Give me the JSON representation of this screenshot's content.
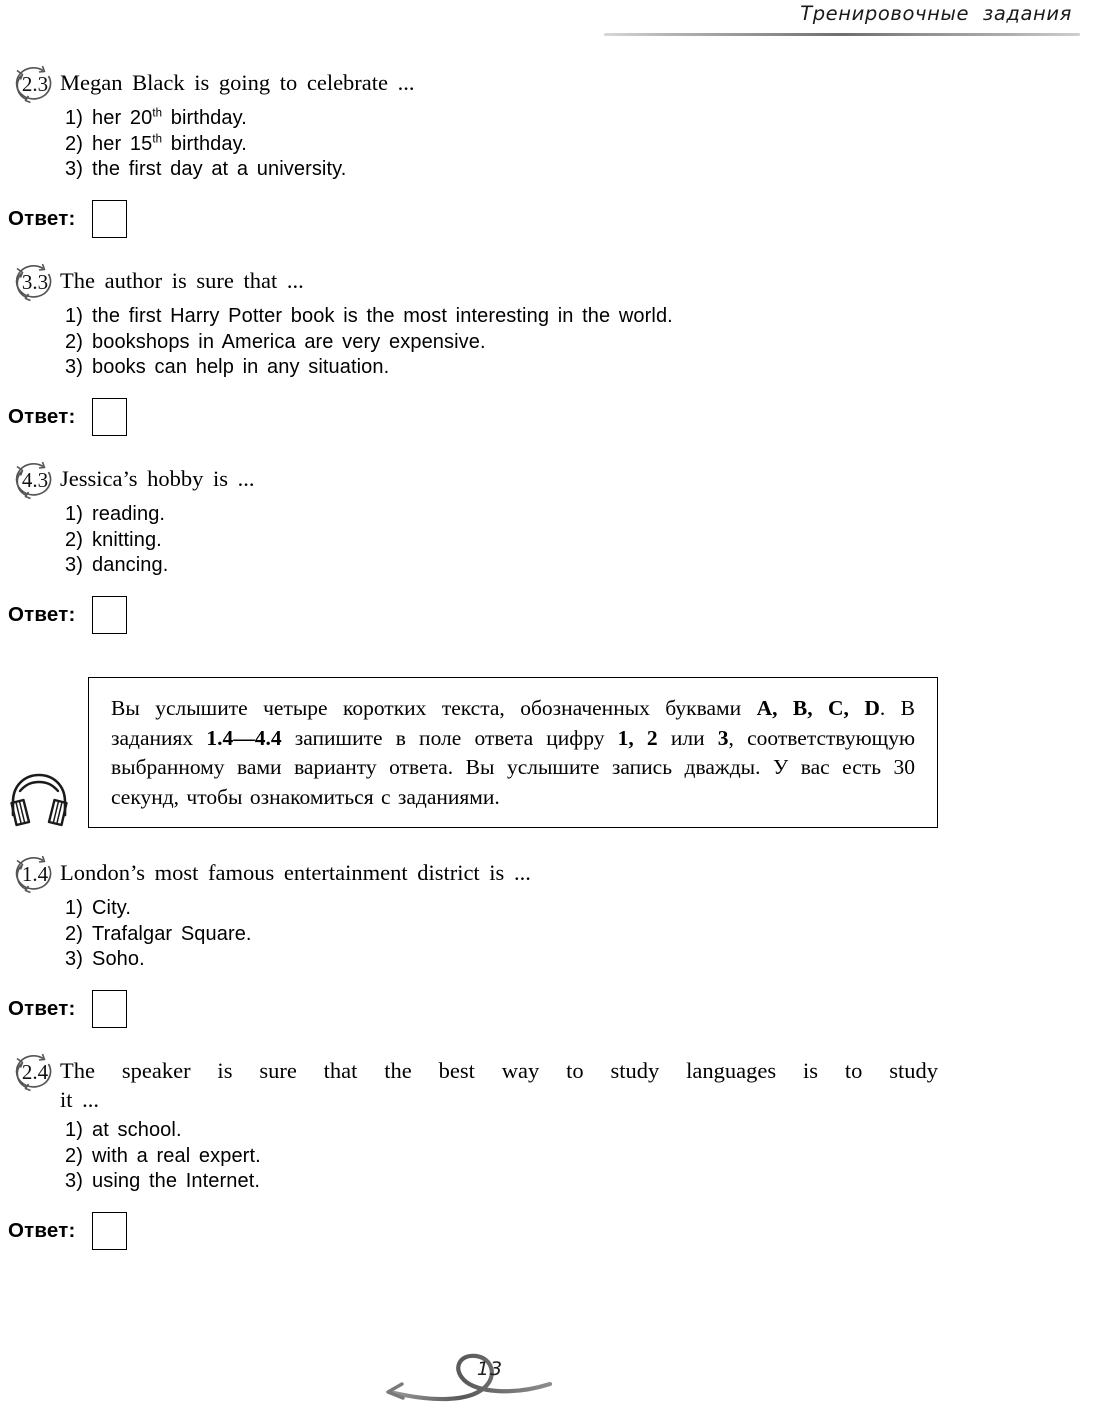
{
  "header": {
    "running_title": "Тренировочные  задания"
  },
  "questions": [
    {
      "number": "2.3",
      "marker_icon": "circular-arrow-icon",
      "prompt_lines": [
        "Megan  Black  is  going  to  celebrate  ..."
      ],
      "options": [
        {
          "num": "1)",
          "text": "her  20",
          "sup": "th",
          "tail": "  birthday."
        },
        {
          "num": "2)",
          "text": "her  15",
          "sup": "th",
          "tail": "  birthday."
        },
        {
          "num": "3)",
          "text": "the  first  day  at  a  university.",
          "sup": "",
          "tail": ""
        }
      ],
      "answer_label": "Ответ:",
      "answer_value": ""
    },
    {
      "number": "3.3",
      "marker_icon": "circular-arrow-icon",
      "prompt_lines": [
        "The  author  is  sure  that  ..."
      ],
      "options": [
        {
          "num": "1)",
          "text": "the  first  Harry  Potter  book  is  the  most  interesting  in  the  world.",
          "sup": "",
          "tail": ""
        },
        {
          "num": "2)",
          "text": "bookshops  in  America  are  very  expensive.",
          "sup": "",
          "tail": ""
        },
        {
          "num": "3)",
          "text": "books  can  help  in  any  situation.",
          "sup": "",
          "tail": ""
        }
      ],
      "answer_label": "Ответ:",
      "answer_value": ""
    },
    {
      "number": "4.3",
      "marker_icon": "circular-arrow-icon",
      "prompt_lines": [
        "Jessica’s  hobby  is  ..."
      ],
      "options": [
        {
          "num": "1)",
          "text": "reading.",
          "sup": "",
          "tail": ""
        },
        {
          "num": "2)",
          "text": "knitting.",
          "sup": "",
          "tail": ""
        },
        {
          "num": "3)",
          "text": "dancing.",
          "sup": "",
          "tail": ""
        }
      ],
      "answer_label": "Ответ:",
      "answer_value": ""
    },
    {
      "number": "1.4",
      "marker_icon": "circular-arrow-icon",
      "prompt_lines": [
        "London’s  most  famous  entertainment  district  is  ..."
      ],
      "options": [
        {
          "num": "1)",
          "text": "City.",
          "sup": "",
          "tail": ""
        },
        {
          "num": "2)",
          "text": "Trafalgar  Square.",
          "sup": "",
          "tail": ""
        },
        {
          "num": "3)",
          "text": "Soho.",
          "sup": "",
          "tail": ""
        }
      ],
      "answer_label": "Ответ:",
      "answer_value": ""
    },
    {
      "number": "2.4",
      "marker_icon": "circular-arrow-icon",
      "prompt_lines": [
        "The  speaker  is  sure  that  the  best  way  to  study  languages  is  to  study",
        "it  ..."
      ],
      "options": [
        {
          "num": "1)",
          "text": "at  school.",
          "sup": "",
          "tail": ""
        },
        {
          "num": "2)",
          "text": "with  a  real  expert.",
          "sup": "",
          "tail": ""
        },
        {
          "num": "3)",
          "text": "using  the  Internet.",
          "sup": "",
          "tail": ""
        }
      ],
      "answer_label": "Ответ:",
      "answer_value": ""
    }
  ],
  "listening_panel": {
    "icon": "headphones-icon",
    "segments": [
      {
        "text": "Вы услышите четыре коротких текста, обозначенных буквами ",
        "bold": false
      },
      {
        "text": "A, B, C, D",
        "bold": true
      },
      {
        "text": ". В заданиях ",
        "bold": false
      },
      {
        "text": "1.4—4.4",
        "bold": true
      },
      {
        "text": " запишите в поле ответа цифру ",
        "bold": false
      },
      {
        "text": "1, 2",
        "bold": true
      },
      {
        "text": " или ",
        "bold": false
      },
      {
        "text": "3",
        "bold": true
      },
      {
        "text": ", соответствующую выбранному вами варианту ответа. Вы услышите запись дважды. У вас есть 30 секунд, чтобы ознакомиться с заданиями.",
        "bold": false
      }
    ]
  },
  "footer": {
    "page_number": "13",
    "ornament": "swirl-arrow-ornament"
  }
}
